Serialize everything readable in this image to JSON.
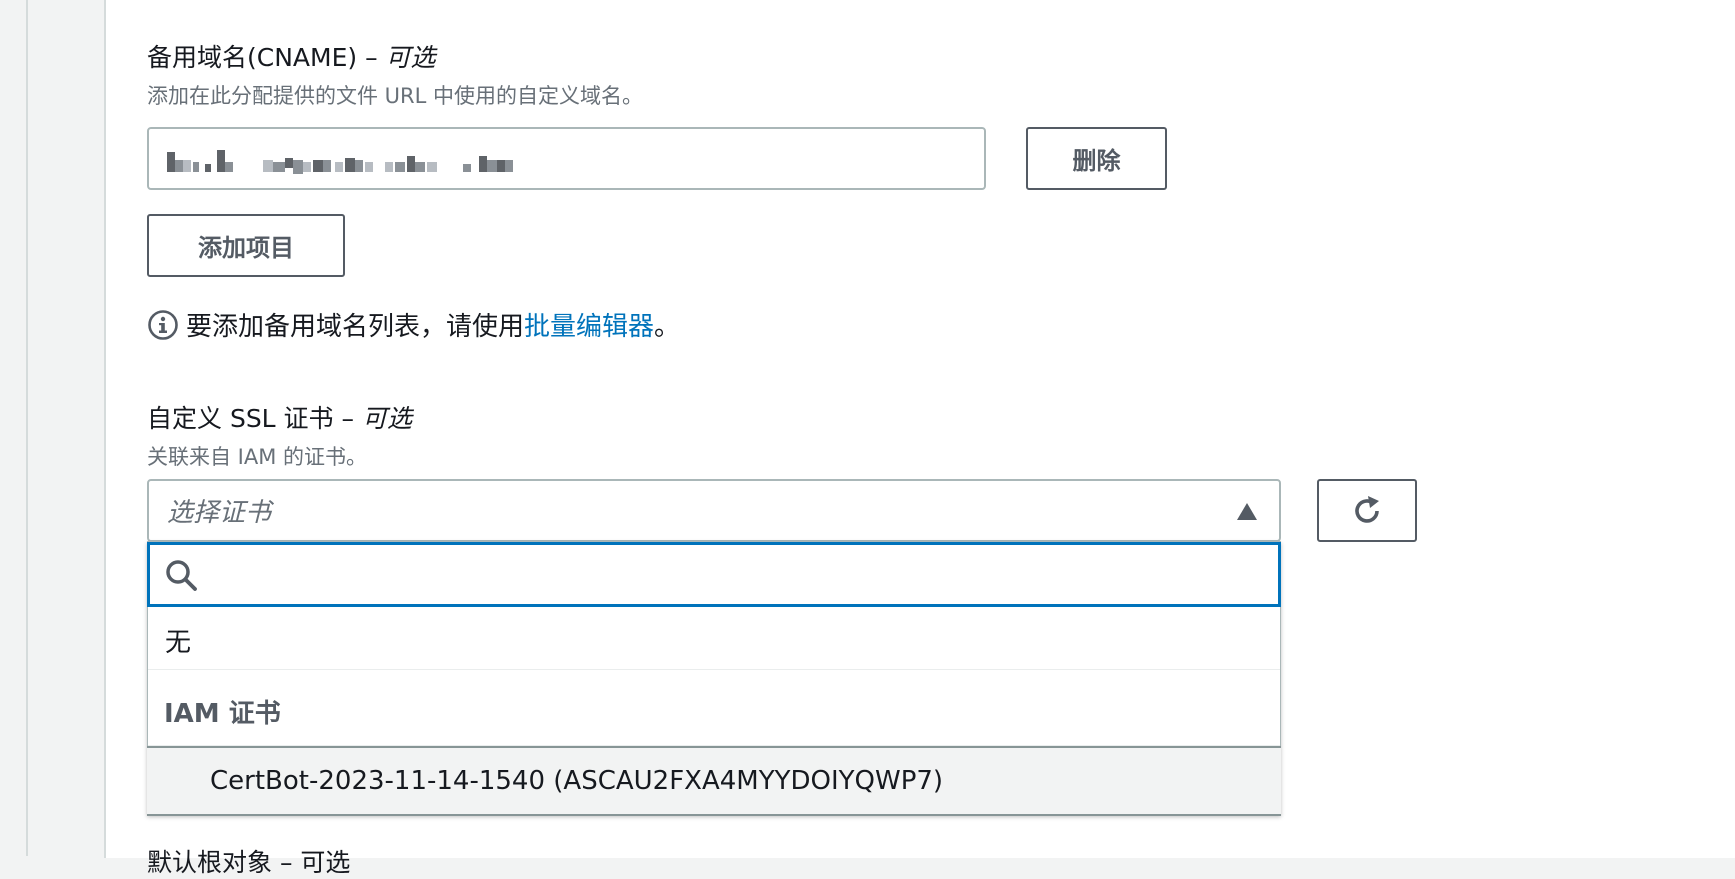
{
  "cname": {
    "label": "备用域名(CNAME) – ",
    "optional": "可选",
    "description": "添加在此分配提供的文件 URL 中使用的自定义域名。",
    "remove_button": "删除",
    "add_button": "添加项目",
    "info_prefix": "要添加备用域名列表，请使用 ",
    "info_link": "批量编辑器",
    "info_suffix": "。"
  },
  "ssl": {
    "label": "自定义 SSL 证书 – ",
    "optional": "可选",
    "description": "关联来自 IAM 的证书。",
    "select_placeholder": "选择证书",
    "search_placeholder": "",
    "option_none": "无",
    "group_title": "IAM 证书",
    "certificate_option": "CertBot-2023-11-14-1540 (ASCAU2FXA4MYYDOIYQWP7)"
  },
  "next_field": {
    "label_partial": "默认根对象 – 可选"
  },
  "colors": {
    "accent_blue": "#0073bb",
    "border_gray": "#aab7b8",
    "text_dark": "#16191f",
    "text_muted": "#687078"
  }
}
